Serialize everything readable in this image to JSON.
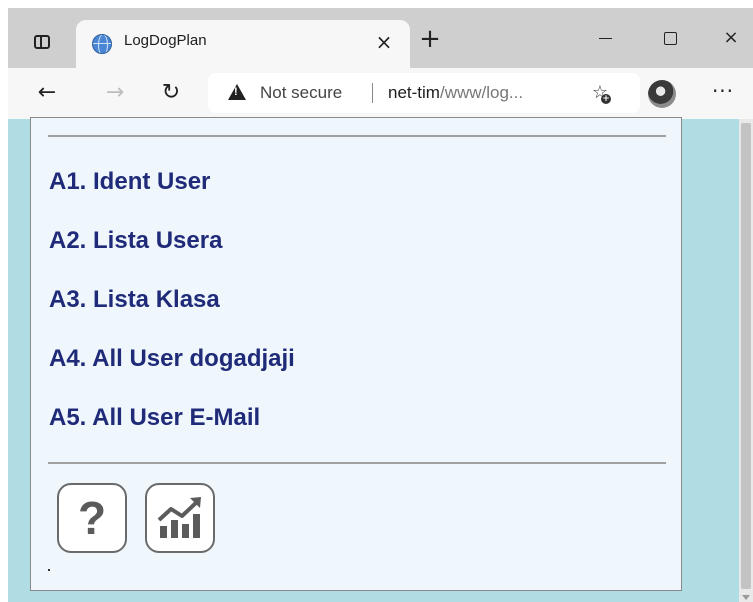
{
  "browser": {
    "tab": {
      "title": "LogDogPlan",
      "close_glyph": "×"
    },
    "new_tab_glyph": "+",
    "window_controls": {
      "close_glyph": "×"
    },
    "nav": {
      "back_glyph": "←",
      "forward_glyph": "→",
      "reload_glyph": "↻"
    },
    "address": {
      "security_label": "Not secure",
      "url_host": "net-tim",
      "url_path": "/www/log..."
    },
    "more_glyph": "···"
  },
  "page": {
    "menu_items": [
      {
        "label": "A1. Ident User"
      },
      {
        "label": "A2. Lista Usera"
      },
      {
        "label": "A3. Lista Klasa"
      },
      {
        "label": "A4. All User dogadjaji"
      },
      {
        "label": "A5. All User E-Mail"
      }
    ],
    "help_button_glyph": "?"
  },
  "colors": {
    "page_background": "#b0dde4",
    "panel_background": "#eff7fd",
    "link": "#1f2a78",
    "icon_gray": "#5b5b5b"
  },
  "icons": {
    "tab_favicon": "globe-icon",
    "security": "warning-triangle-icon",
    "favorites": "star-add-icon",
    "profile": "avatar",
    "help": "question-mark-icon",
    "stats": "chart-trend-icon"
  }
}
